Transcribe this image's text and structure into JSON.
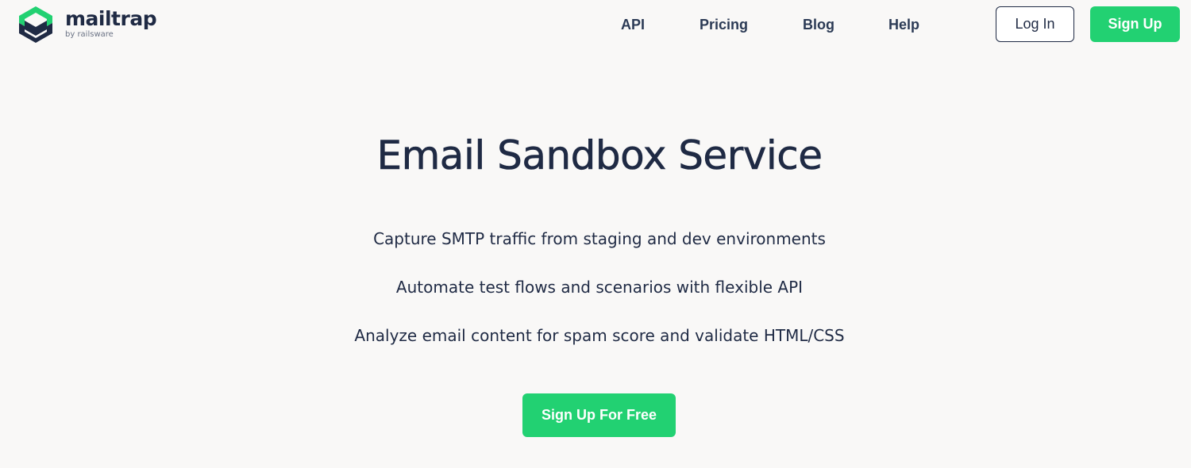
{
  "brand": {
    "name": "mailtrap",
    "byline": "by railsware",
    "logo_icon": "mailtrap-hexagon-m-logo",
    "logo_dark": "#1f2a44",
    "logo_green": "#22d172"
  },
  "nav": {
    "items": [
      {
        "label": "API"
      },
      {
        "label": "Pricing"
      },
      {
        "label": "Blog"
      },
      {
        "label": "Help"
      }
    ],
    "login_label": "Log In",
    "signup_label": "Sign Up"
  },
  "hero": {
    "title": "Email Sandbox Service",
    "features": [
      "Capture SMTP traffic from staging and dev environments",
      "Automate test flows and scenarios with flexible API",
      "Analyze email content for spam score and validate HTML/CSS"
    ],
    "cta_label": "Sign Up For Free"
  },
  "colors": {
    "background": "#f9f8f7",
    "accent": "#22d172",
    "text": "#1f2a44"
  }
}
